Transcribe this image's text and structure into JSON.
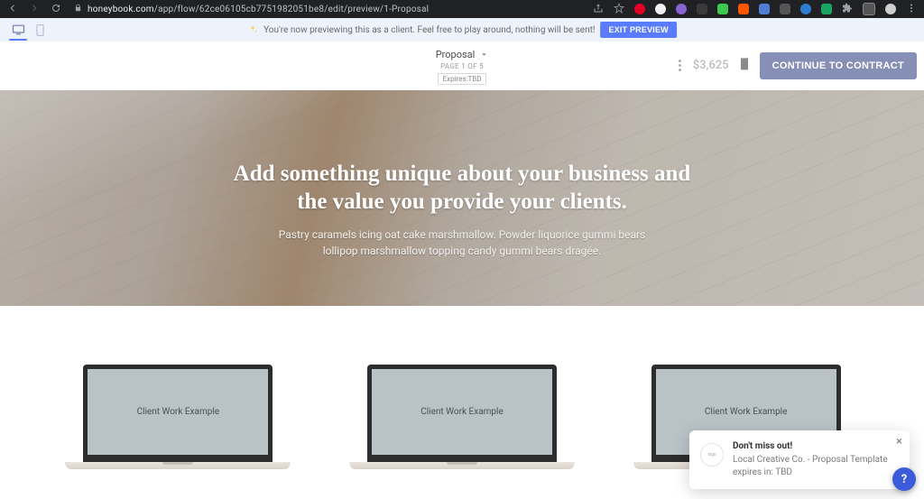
{
  "browser": {
    "url_domain": "honeybook.com",
    "url_path": "/app/flow/62ce06105cb7751982051be8/edit/preview/1-Proposal"
  },
  "preview_bar": {
    "message": "You're now previewing this as a client. Feel free to play around, nothing will be sent!",
    "exit_label": "EXIT PREVIEW"
  },
  "sub_header": {
    "title": "Proposal",
    "page_indicator": "PAGE 1 OF 5",
    "expires": "Expires:TBD",
    "price": "$3,625",
    "cta": "CONTINUE TO CONTRACT"
  },
  "hero": {
    "heading": "Add something unique about your business and the value you provide your clients.",
    "subtext": "Pastry caramels icing oat cake marshmallow. Powder liquorice gummi bears lollipop marshmallow topping candy gummi bears dragée."
  },
  "portfolio": {
    "items": [
      {
        "label": "Client Work Example"
      },
      {
        "label": "Client Work Example"
      },
      {
        "label": "Client Work Example"
      }
    ]
  },
  "notification": {
    "title": "Don't miss out!",
    "body": "Local Creative Co. - Proposal Template expires in: TBD"
  },
  "help_fab": {
    "label": "?"
  }
}
